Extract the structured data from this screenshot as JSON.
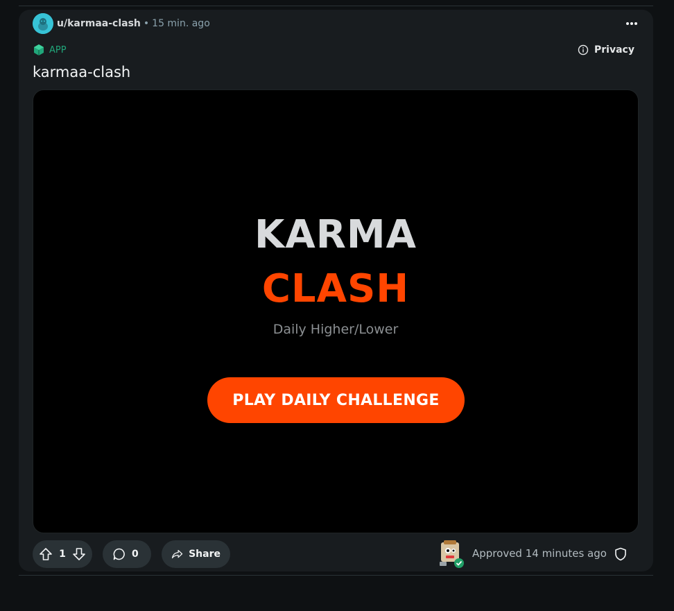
{
  "post": {
    "author": "u/karmaa-clash",
    "separator": "•",
    "time": "15 min. ago",
    "app_label": "APP",
    "privacy_label": "Privacy",
    "title": "karmaa-clash"
  },
  "game": {
    "title_line1": "KARMA",
    "title_line2": "CLASH",
    "subtitle": "Daily Higher/Lower",
    "play_label": "PLAY DAILY CHALLENGE"
  },
  "actions": {
    "score": "1",
    "comments": "0",
    "share_label": "Share"
  },
  "moderation": {
    "approved_text": "Approved 14 minutes ago"
  },
  "icons": {
    "avatar": "snoo-avatar-icon",
    "more": "ellipsis-icon",
    "app": "cube-icon",
    "privacy": "info-icon",
    "upvote": "arrow-up-icon",
    "downvote": "arrow-down-icon",
    "comment": "speech-bubble-icon",
    "share": "share-arrow-icon",
    "mod": "shield-icon"
  },
  "colors": {
    "accent": "#ff4500",
    "app_green": "#21a67a",
    "card_bg": "#181c1f",
    "page_bg": "#0e1113"
  }
}
